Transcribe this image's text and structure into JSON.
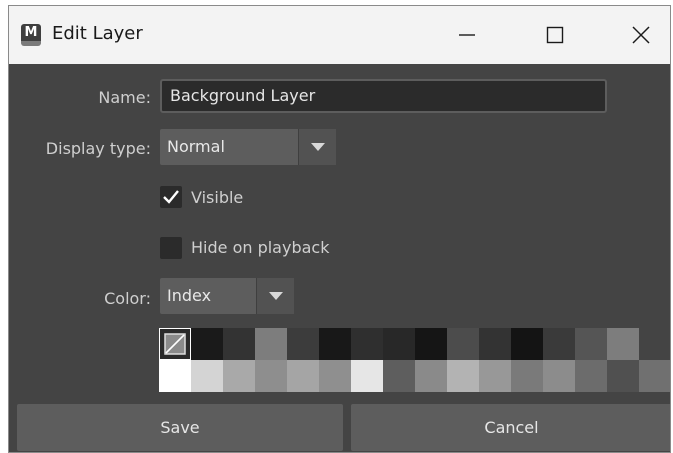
{
  "window": {
    "title": "Edit Layer",
    "app_icon_letter": "M",
    "minimize_glyph": "—",
    "maximize_glyph": "☐",
    "close_glyph": "✕"
  },
  "form": {
    "name_label": "Name:",
    "name_value": "Background Layer",
    "display_type_label": "Display type:",
    "display_type_value": "Normal",
    "visible_label": "Visible",
    "visible_checked": true,
    "hide_on_playback_label": "Hide on playback",
    "hide_on_playback_checked": false,
    "color_label": "Color:",
    "color_mode_value": "Index"
  },
  "palette": {
    "row1": [
      "#2a2a2a",
      "#1a1a1a",
      "#333333",
      "#7d7d7d",
      "#3c3c3c",
      "#181818",
      "#2f2f2f",
      "#282828",
      "#151515",
      "#4c4c4c",
      "#333333",
      "#141414",
      "#3a3a3a",
      "#555555",
      "#7d7d7d",
      "#444444"
    ],
    "row2": [
      "#ffffff",
      "#d4d4d4",
      "#a9a9a9",
      "#8e8e8e",
      "#a5a5a5",
      "#8f8f8f",
      "#e6e6e6",
      "#5e5e5e",
      "#8a8a8a",
      "#b3b3b3",
      "#989898",
      "#7a7a7a",
      "#8c8c8c",
      "#6c6c6c",
      "#505050",
      "#707070"
    ]
  },
  "buttons": {
    "save_label": "Save",
    "cancel_label": "Cancel"
  }
}
